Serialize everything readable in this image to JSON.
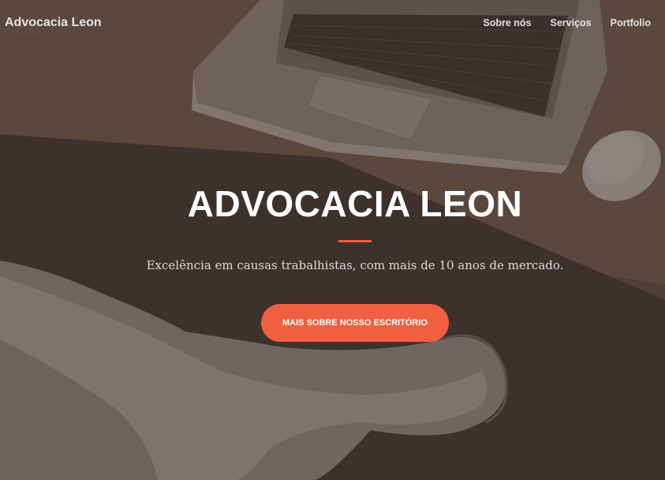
{
  "navbar": {
    "brand": "Advocacia Leon",
    "links": [
      {
        "label": "Sobre nós"
      },
      {
        "label": "Serviços"
      },
      {
        "label": "Portfolio"
      }
    ]
  },
  "hero": {
    "title": "ADVOCACIA LEON",
    "subtitle": "Excelência em causas trabalhistas, com mais de 10 anos de mercado.",
    "cta_label": "MAIS SOBRE NOSSO ESCRITÓRIO"
  },
  "colors": {
    "accent": "#f05f40",
    "overlay": "#3a2d28"
  }
}
